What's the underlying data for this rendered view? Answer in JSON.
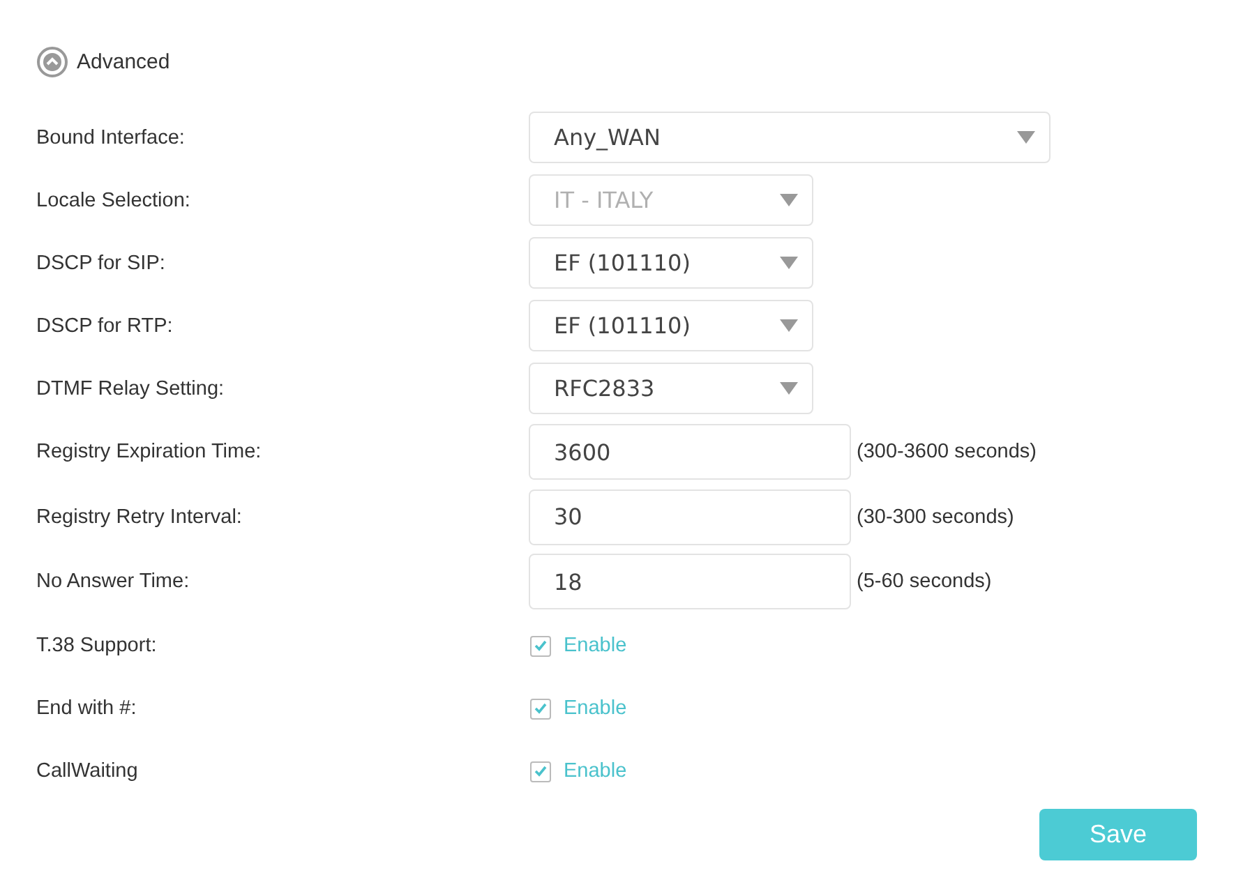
{
  "section": {
    "title": "Advanced",
    "expanded": true
  },
  "fields": [
    {
      "kind": "select",
      "label": "Bound Interface:",
      "value": "Any_WAN",
      "wide": true,
      "disabled": false
    },
    {
      "kind": "select",
      "label": "Locale Selection:",
      "value": "IT - ITALY",
      "wide": false,
      "disabled": true
    },
    {
      "kind": "select",
      "label": "DSCP for SIP:",
      "value": "EF (101110)",
      "wide": false,
      "disabled": false
    },
    {
      "kind": "select",
      "label": "DSCP for RTP:",
      "value": "EF (101110)",
      "wide": false,
      "disabled": false
    },
    {
      "kind": "select",
      "label": "DTMF Relay Setting:",
      "value": "RFC2833",
      "wide": false,
      "disabled": false
    },
    {
      "kind": "text",
      "label": "Registry Expiration Time:",
      "value": "3600",
      "hint": "(300-3600 seconds)"
    },
    {
      "kind": "text",
      "label": "Registry Retry Interval:",
      "value": "30",
      "hint": "(30-300 seconds)"
    },
    {
      "kind": "text",
      "label": "No Answer Time:",
      "value": "18",
      "hint": "(5-60 seconds)"
    },
    {
      "kind": "checkbox",
      "label": "T.38 Support:",
      "option": "Enable",
      "checked": true
    },
    {
      "kind": "checkbox",
      "label": "End with #:",
      "option": "Enable",
      "checked": true
    },
    {
      "kind": "checkbox",
      "label": "CallWaiting",
      "option": "Enable",
      "checked": true
    }
  ],
  "save_button": "Save"
}
